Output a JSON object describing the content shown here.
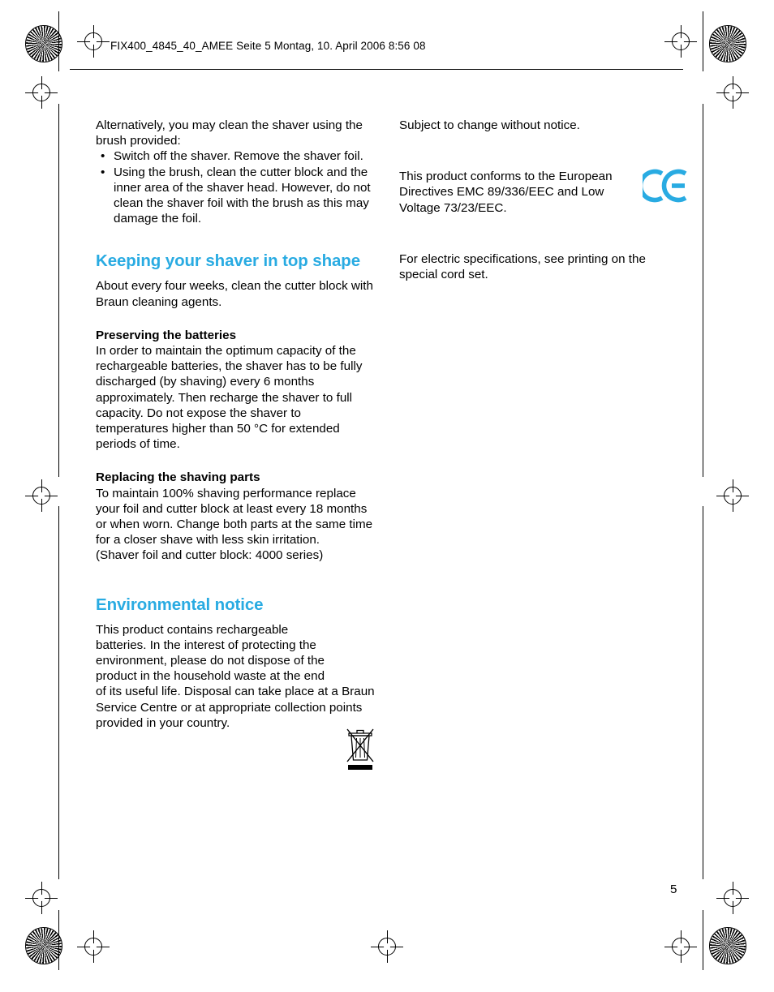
{
  "header": {
    "text": "FIX400_4845_40_AMEE  Seite 5  Montag, 10. April 2006  8:56 08"
  },
  "left_column": {
    "intro_paragraph": "Alternatively, you may clean the shaver using the brush provided:",
    "bullets": [
      "Switch off the shaver. Remove the shaver foil.",
      "Using the brush, clean the cutter block and the inner area of the shaver head. However, do not clean the shaver foil with the brush as this may damage the foil."
    ],
    "section_keeping": {
      "heading": "Keeping your shaver in top shape",
      "paragraph": "About every four weeks, clean the cutter block with Braun cleaning agents.",
      "sub_batteries": {
        "heading": "Preserving the batteries",
        "paragraph": "In order to maintain the optimum capacity of the rechargeable batteries, the shaver has to be fully discharged (by shaving) every 6 months approximately. Then recharge the shaver to full capacity. Do not expose the shaver to temperatures higher than 50 °C for extended periods of time."
      },
      "sub_replacing": {
        "heading": "Replacing the shaving parts",
        "paragraph": "To maintain 100% shaving performance replace your foil and cutter block at least every 18 months or when worn. Change both parts at the same time for a closer shave with less skin irritation.",
        "paragraph2": "(Shaver foil and cutter block: 4000 series)"
      }
    },
    "section_environmental": {
      "heading": "Environmental notice",
      "paragraph": "This product contains rechargeable batteries. In the interest of protecting the environment, please do not dispose of the product in the household waste at the end of its useful life. Disposal can take place at a Braun Service Centre or at appropriate collection points provided in your country."
    }
  },
  "right_column": {
    "notice": "Subject to change without notice.",
    "conformity": "This product conforms to the European Directives EMC 89/336/EEC and Low Voltage 73/23/EEC.",
    "specifications": "For electric specifications, see printing on the special cord set."
  },
  "footer": {
    "page_number": "5"
  },
  "colors": {
    "accent": "#29ABE2",
    "text": "#000000",
    "background": "#FFFFFF"
  },
  "bullet_glyph": "•"
}
